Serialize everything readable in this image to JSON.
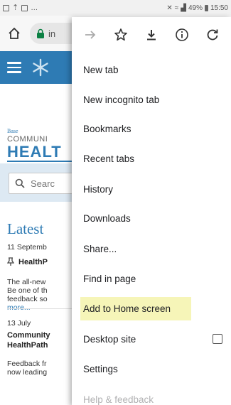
{
  "status_bar": {
    "battery": "49%",
    "time": "15:50"
  },
  "toolbar": {
    "url_fragment": "in"
  },
  "page": {
    "brand_small": "Base",
    "brand_community": "COMMUNI",
    "brand_health": "HEALT",
    "search_placeholder": "Searc",
    "latest_heading": "Latest",
    "date_1": "11 Septemb",
    "article_1_title": "HealthP",
    "article_1_line_1": "The all-new",
    "article_1_line_2": "Be one of th",
    "article_1_line_3": "feedback so",
    "article_1_more": "more...",
    "date_2": "13 July",
    "article_2_title_1": "Community",
    "article_2_title_2": "HealthPath",
    "article_2_line_1": "Feedback fr",
    "article_2_line_2": "now leading"
  },
  "menu": {
    "items": [
      {
        "label": "New tab"
      },
      {
        "label": "New incognito tab"
      },
      {
        "label": "Bookmarks"
      },
      {
        "label": "Recent tabs"
      },
      {
        "label": "History"
      },
      {
        "label": "Downloads"
      },
      {
        "label": "Share..."
      },
      {
        "label": "Find in page"
      },
      {
        "label": "Add to Home screen"
      },
      {
        "label": "Desktop site"
      },
      {
        "label": "Settings"
      },
      {
        "label": "Help & feedback"
      }
    ],
    "highlight_color": "#f6f5b8"
  },
  "colors": {
    "brand_blue": "#2e7bb4"
  }
}
